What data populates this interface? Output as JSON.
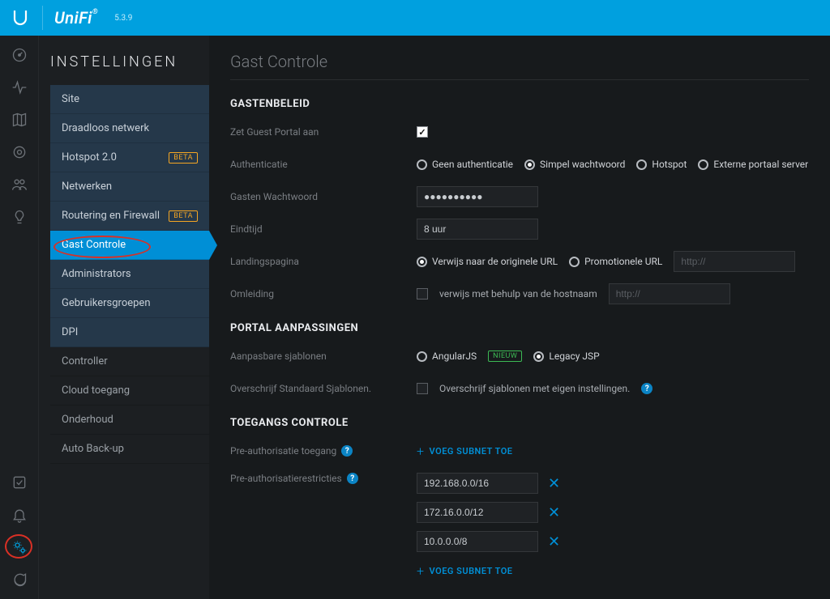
{
  "brand": "UniFi",
  "version": "5.3.9",
  "sidebar": {
    "title": "INSTELLINGEN",
    "items": [
      {
        "label": "Site"
      },
      {
        "label": "Draadloos netwerk"
      },
      {
        "label": "Hotspot 2.0",
        "beta": "BETA"
      },
      {
        "label": "Netwerken"
      },
      {
        "label": "Routering en Firewall",
        "beta": "BETA"
      },
      {
        "label": "Gast Controle"
      },
      {
        "label": "Administrators"
      },
      {
        "label": "Gebruikersgroepen"
      },
      {
        "label": "DPI"
      },
      {
        "label": "Controller"
      },
      {
        "label": "Cloud toegang"
      },
      {
        "label": "Onderhoud"
      },
      {
        "label": "Auto Back-up"
      }
    ]
  },
  "page": {
    "title": "Gast Controle",
    "section1": "GASTENBELEID",
    "labels": {
      "enable": "Zet Guest Portal aan",
      "auth": "Authenticatie",
      "password": "Gasten Wachtwoord",
      "endtime": "Eindtijd",
      "landing": "Landingspagina",
      "redirect": "Omleiding"
    },
    "auth_options": {
      "none": "Geen authenticatie",
      "simple": "Simpel wachtwoord",
      "hotspot": "Hotspot",
      "external": "Externe portaal server"
    },
    "password_value": "●●●●●●●●●●",
    "endtime_value": "8 uur",
    "landing_options": {
      "original": "Verwijs naar de originele URL",
      "promo": "Promotionele URL"
    },
    "url_placeholder": "http://",
    "redirect_hostname": "verwijs met behulp van de hostnaam",
    "section2": "PORTAL AANPASSINGEN",
    "labels2": {
      "templates": "Aanpasbare sjablonen",
      "override": "Overschrijf Standaard Sjablonen."
    },
    "template_options": {
      "angular": "AngularJS",
      "nieuw": "NIEUW",
      "legacy": "Legacy JSP"
    },
    "override_text": "Overschrijf sjablonen met eigen instellingen.",
    "section3": "TOEGANGS CONTROLE",
    "labels3": {
      "preauth_access": "Pre-authorisatie toegang",
      "preauth_restrict": "Pre-authorisatierestricties"
    },
    "add_subnet": "VOEG SUBNET TOE",
    "subnets": [
      "192.168.0.0/16",
      "172.16.0.0/12",
      "10.0.0.0/8"
    ]
  }
}
